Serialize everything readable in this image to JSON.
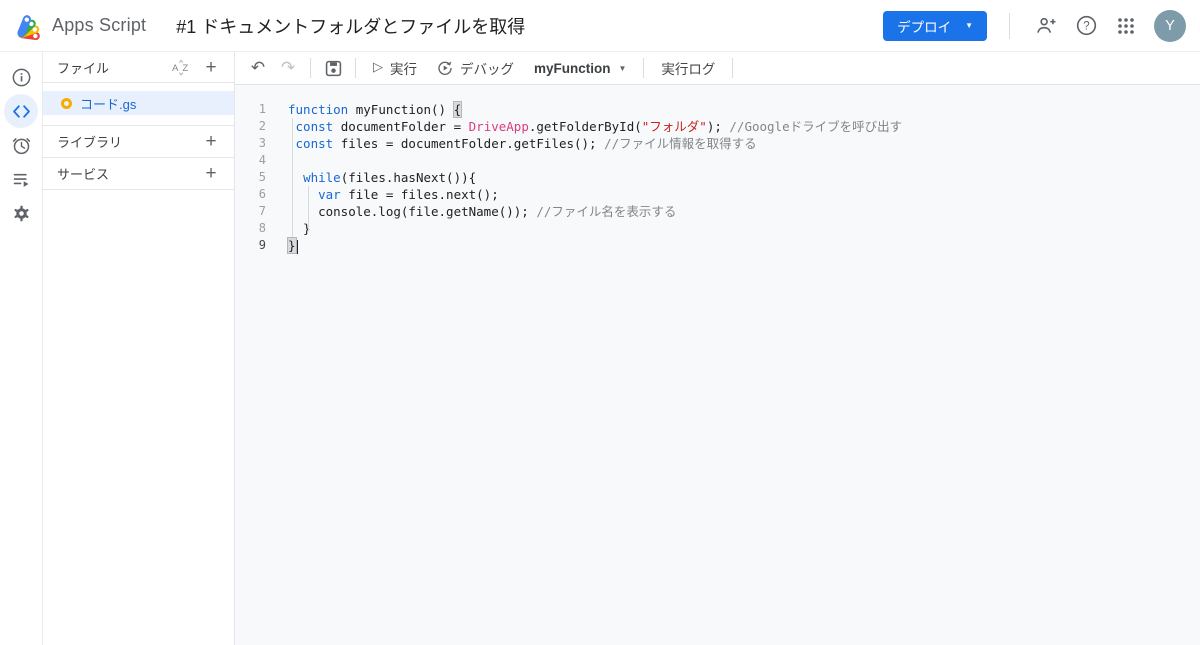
{
  "colors": {
    "accent_blue": "#1a73e8",
    "selected_bg": "#e8f0fe",
    "selected_text": "#1967d2",
    "icon_gray": "#5f6368",
    "editor_bg": "#f8f9fa",
    "avatar_bg": "#7e9ba9",
    "gs_icon_orange": "#f9ab00",
    "syntax": {
      "keyword": "#1967d2",
      "plain": "#202124",
      "builtin": "#d93d83",
      "string": "#c5221f",
      "comment": "#80868b"
    }
  },
  "header": {
    "app_name": "Apps Script",
    "project_title": "#1 ドキュメントフォルダとファイルを取得",
    "deploy_label": "デプロイ",
    "avatar_letter": "Y"
  },
  "files_panel": {
    "files_header": "ファイル",
    "files": [
      {
        "name": "コード.gs",
        "selected": true
      }
    ],
    "libraries_label": "ライブラリ",
    "services_label": "サービス"
  },
  "toolbar": {
    "undo_glyph": "↶",
    "redo_glyph": "↷",
    "run_glyph": "▷",
    "run_label": "実行",
    "debug_label": "デバッグ",
    "function_name": "myFunction",
    "execution_log_label": "実行ログ"
  },
  "editor": {
    "lines": [
      {
        "n": 1,
        "seg": [
          [
            "k",
            "function"
          ],
          [
            "p",
            " myFunction() "
          ],
          [
            "m",
            "{"
          ]
        ]
      },
      {
        "n": 2,
        "seg": [
          [
            "p",
            " "
          ],
          [
            "k",
            "const"
          ],
          [
            "p",
            " documentFolder = "
          ],
          [
            "b",
            "DriveApp"
          ],
          [
            "p",
            ".getFolderById("
          ],
          [
            "s",
            "\"フォルダ\""
          ],
          [
            "p",
            "); "
          ],
          [
            "c",
            "//Googleドライブを呼び出す"
          ]
        ]
      },
      {
        "n": 3,
        "seg": [
          [
            "p",
            " "
          ],
          [
            "k",
            "const"
          ],
          [
            "p",
            " files = documentFolder.getFiles(); "
          ],
          [
            "c",
            "//ファイル情報を取得する"
          ]
        ]
      },
      {
        "n": 4,
        "seg": []
      },
      {
        "n": 5,
        "seg": [
          [
            "p",
            "  "
          ],
          [
            "k",
            "while"
          ],
          [
            "p",
            "(files.hasNext()){"
          ]
        ]
      },
      {
        "n": 6,
        "seg": [
          [
            "p",
            "    "
          ],
          [
            "k",
            "var"
          ],
          [
            "p",
            " file = files.next();"
          ]
        ]
      },
      {
        "n": 7,
        "seg": [
          [
            "p",
            "    console.log(file.getName()); "
          ],
          [
            "c",
            "//ファイル名を表示する"
          ]
        ]
      },
      {
        "n": 8,
        "seg": [
          [
            "p",
            "  }"
          ]
        ]
      },
      {
        "n": 9,
        "seg": [
          [
            "m",
            "}"
          ]
        ],
        "active": true,
        "cursor": true
      }
    ]
  }
}
